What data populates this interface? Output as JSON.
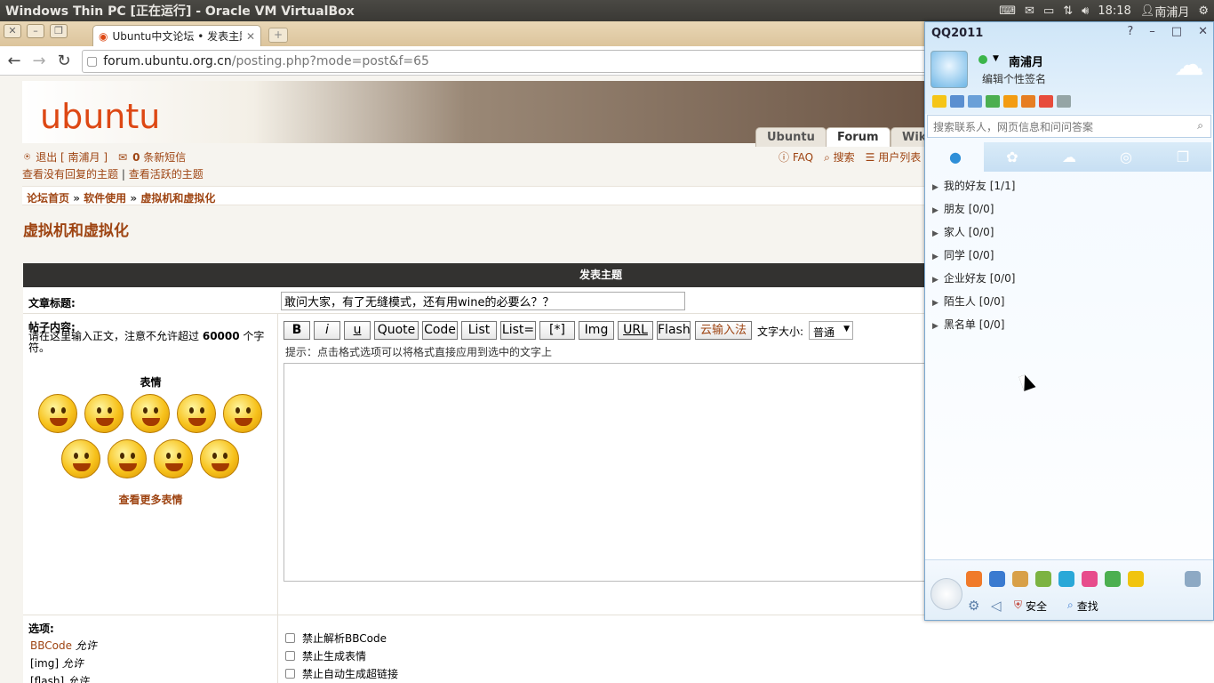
{
  "system": {
    "window_title": "Windows Thin PC [正在运行] - Oracle VM VirtualBox",
    "time": "18:18",
    "user": "南浦月"
  },
  "browser": {
    "tab_title": "Ubuntu中文论坛 • 发表主题",
    "url_host": "forum.ubuntu.org.cn",
    "url_path": "/posting.php?mode=post&f=65"
  },
  "forum": {
    "logo_text": "ubuntu",
    "nav_tabs": [
      "Ubuntu",
      "Forum",
      "Wiki"
    ],
    "logout": "退出 [ 南浦月 ]",
    "msg_count": "0",
    "msg_label": "条新短信",
    "no_reply": "查看没有回复的主题",
    "sep": "|",
    "active": "查看活跃的主题",
    "faq": "FAQ",
    "search": "搜索",
    "members": "用户列表",
    "breadcrumb": [
      "论坛首页",
      "软件使用",
      "虚拟机和虚拟化"
    ],
    "crumb_sep": "»",
    "page_title": "虚拟机和虚拟化",
    "form_header": "发表主题",
    "subject_label": "文章标题:",
    "subject_value": "敢问大家，有了无缝模式，还有用wine的必要么？？",
    "content_label": "帖子内容:",
    "content_hint_a": "请在这里输入正文，注意不允许超过",
    "content_hint_num": "60000",
    "content_hint_b": "个字符。",
    "smilies_title": "表情",
    "more_smilies": "查看更多表情",
    "buttons": [
      "B",
      "i",
      "u",
      "Quote",
      "Code",
      "List",
      "List=",
      "[*]",
      "Img",
      "URL",
      "Flash",
      "云输入法"
    ],
    "font_size_label": "文字大小:",
    "font_size_value": "普通",
    "tip": "提示：点击格式选项可以将格式直接应用到选中的文字上",
    "options_label": "选项:",
    "opt_bbcode": "BBCode",
    "opt_img": "[img]",
    "opt_flash": "[flash]",
    "allowed": "允许",
    "checkboxes": [
      "禁止解析BBCode",
      "禁止生成表情",
      "禁止自动生成超链接"
    ]
  },
  "qq": {
    "title": "QQ2011",
    "nickname": "南浦月",
    "signature": "编辑个性签名",
    "search_placeholder": "搜索联系人，网页信息和问问答案",
    "groups": [
      "我的好友 [1/1]",
      "朋友 [0/0]",
      "家人 [0/0]",
      "同学 [0/0]",
      "企业好友 [0/0]",
      "陌生人 [0/0]",
      "黑名单 [0/0]"
    ],
    "security": "安全",
    "find": "查找"
  }
}
